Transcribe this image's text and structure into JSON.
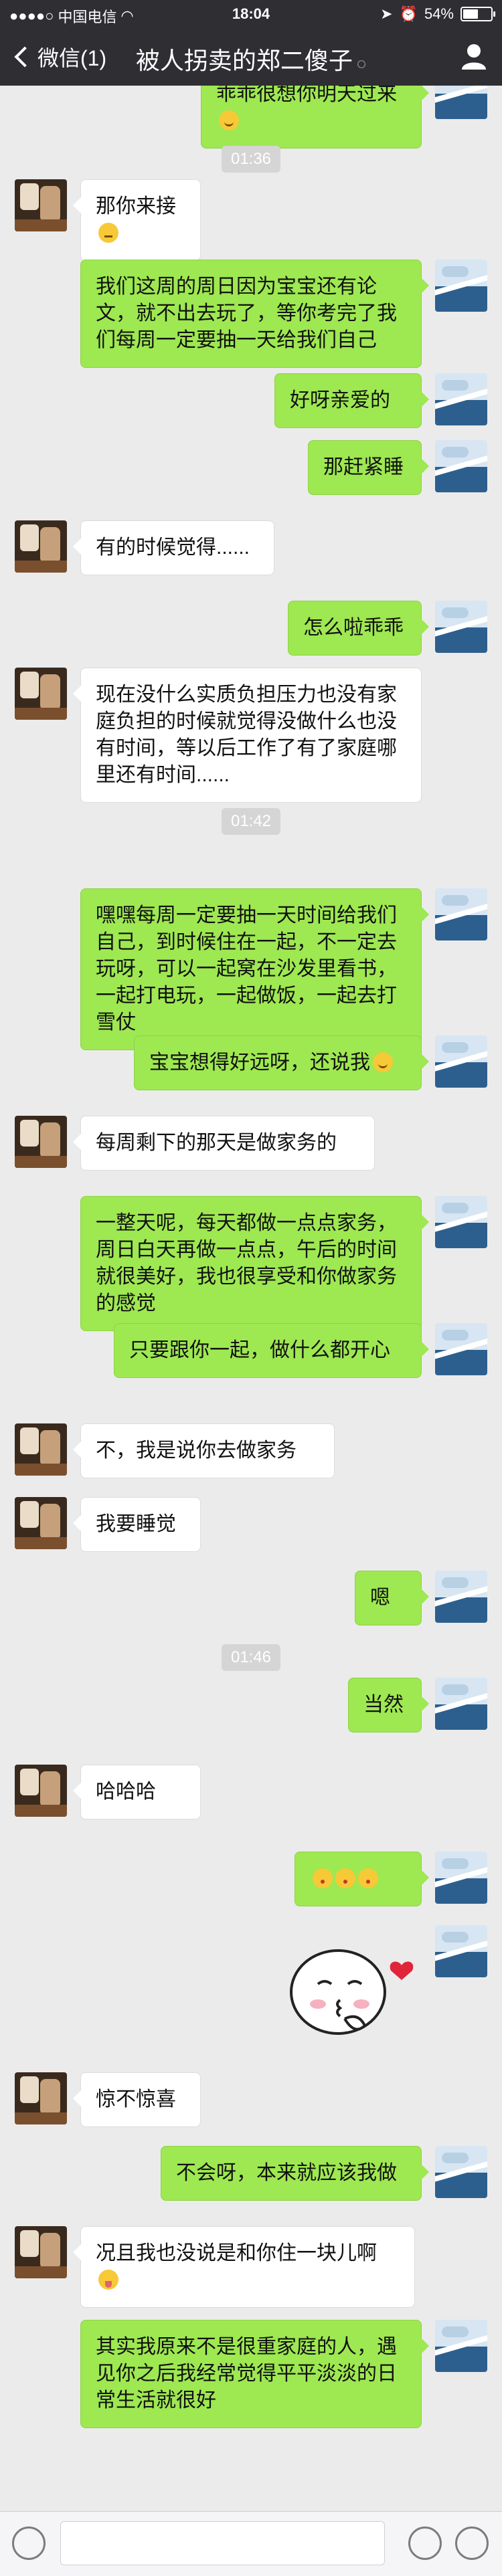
{
  "status_bar": {
    "carrier": "中国电信",
    "time": "18:04",
    "battery": "54%",
    "battery_level": 0.54
  },
  "nav": {
    "back_label": "微信(1)",
    "title": "被人拐卖的郑二傻子"
  },
  "messages": [
    {
      "type": "msg",
      "from": "self",
      "text": "乖乖很想你明天过来",
      "emoji": "smile"
    },
    {
      "type": "time",
      "text": "01:36"
    },
    {
      "type": "msg",
      "from": "friend",
      "text": "那你来接",
      "emoji": "unamused"
    },
    {
      "type": "msg",
      "from": "self",
      "text": "我们这周的周日因为宝宝还有论文，就不出去玩了，等你考完了我们每周一定要抽一天给我们自己"
    },
    {
      "type": "msg",
      "from": "self",
      "text": "好呀亲爱的"
    },
    {
      "type": "msg",
      "from": "self",
      "text": "那赶紧睡"
    },
    {
      "type": "msg",
      "from": "friend",
      "text": "有的时候觉得......"
    },
    {
      "type": "msg",
      "from": "self",
      "text": "怎么啦乖乖"
    },
    {
      "type": "msg",
      "from": "friend",
      "text": "现在没什么实质负担压力也没有家庭负担的时候就觉得没做什么也没有时间，等以后工作了有了家庭哪里还有时间......"
    },
    {
      "type": "time",
      "text": "01:42"
    },
    {
      "type": "msg",
      "from": "self",
      "text": "嘿嘿每周一定要抽一天时间给我们自己，到时候住在一起，不一定去玩呀，可以一起窝在沙发里看书，一起打电玩，一起做饭，一起去打雪仗"
    },
    {
      "type": "msg",
      "from": "self",
      "text": "宝宝想得好远呀，还说我",
      "emoji": "smile"
    },
    {
      "type": "msg",
      "from": "friend",
      "text": "每周剩下的那天是做家务的"
    },
    {
      "type": "msg",
      "from": "self",
      "text": "一整天呢，每天都做一点点家务，周日白天再做一点点，午后的时间就很美好，我也很享受和你做家务的感觉"
    },
    {
      "type": "msg",
      "from": "self",
      "text": "只要跟你一起，做什么都开心"
    },
    {
      "type": "msg",
      "from": "friend",
      "text": "不，我是说你去做家务"
    },
    {
      "type": "msg",
      "from": "friend",
      "text": "我要睡觉"
    },
    {
      "type": "msg",
      "from": "self",
      "text": "嗯"
    },
    {
      "type": "time",
      "text": "01:46"
    },
    {
      "type": "msg",
      "from": "self",
      "text": "当然"
    },
    {
      "type": "msg",
      "from": "friend",
      "text": "哈哈哈"
    },
    {
      "type": "msg",
      "from": "self",
      "text": "",
      "emoji_row": [
        "kiss",
        "kiss",
        "kiss"
      ]
    },
    {
      "type": "sticker",
      "from": "self",
      "name": "blowing-kiss-sticker"
    },
    {
      "type": "msg",
      "from": "friend",
      "text": "惊不惊喜"
    },
    {
      "type": "msg",
      "from": "self",
      "text": "不会呀，本来就应该我做"
    },
    {
      "type": "msg",
      "from": "friend",
      "text": "况且我也没说是和你住一块儿啊",
      "emoji_newline": "tongue"
    },
    {
      "type": "msg",
      "from": "self",
      "text": "其实我原来不是很重家庭的人，遇见你之后我经常觉得平平淡淡的日常生活就很好"
    }
  ],
  "icons": {
    "back": "chevron-left-icon",
    "profile": "person-icon",
    "voice": "voice-icon",
    "emoji": "emoji-icon",
    "plus": "plus-icon"
  },
  "colors": {
    "nav_bg": "#2e2e33",
    "chat_bg": "#ebebeb",
    "self_bubble": "#9ee851",
    "friend_bubble": "#ffffff"
  }
}
